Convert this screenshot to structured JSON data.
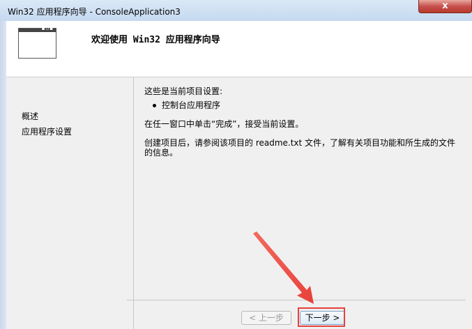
{
  "window": {
    "title": "Win32 应用程序向导 - ConsoleApplication3",
    "close_label": "x"
  },
  "header": {
    "title": "欢迎使用 Win32 应用程序向导"
  },
  "nav": {
    "items": [
      {
        "label": "概述"
      },
      {
        "label": "应用程序设置"
      }
    ]
  },
  "content": {
    "settings_intro": "这些是当前项目设置:",
    "bullet": "控制台应用程序",
    "instruction": "在任一窗口中单击“完成”，接受当前设置。",
    "info_line1": "创建项目后，请参阅该项目的 readme.txt 文件，了解有关项目功能和所生成的文件",
    "info_line2": "的信息。"
  },
  "buttons": {
    "prev": "< 上一步",
    "next": "下一步 >"
  },
  "colors": {
    "annotation": "#e8403a"
  }
}
